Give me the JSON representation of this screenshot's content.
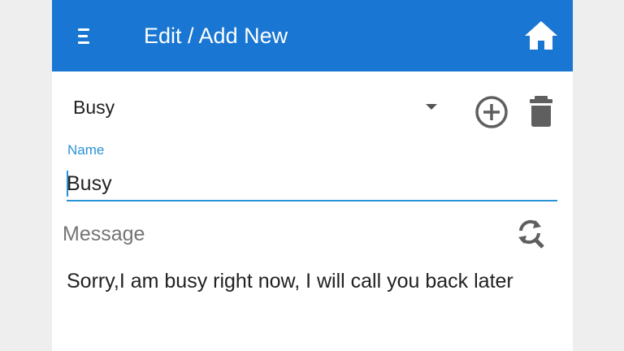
{
  "app_bar": {
    "title": "Edit / Add New",
    "color": "#1976d2",
    "menu_icon": "menu-icon",
    "home_icon": "home-icon"
  },
  "template_selector": {
    "selected": "Busy",
    "add_icon": "add-circle-icon",
    "delete_icon": "trash-icon"
  },
  "name_field": {
    "label": "Name",
    "value": "Busy",
    "accent": "#2a93d5"
  },
  "message_field": {
    "label": "Message",
    "value": "Sorry,I am busy right now, I will call you back later",
    "action_icon": "refresh-search-icon"
  }
}
